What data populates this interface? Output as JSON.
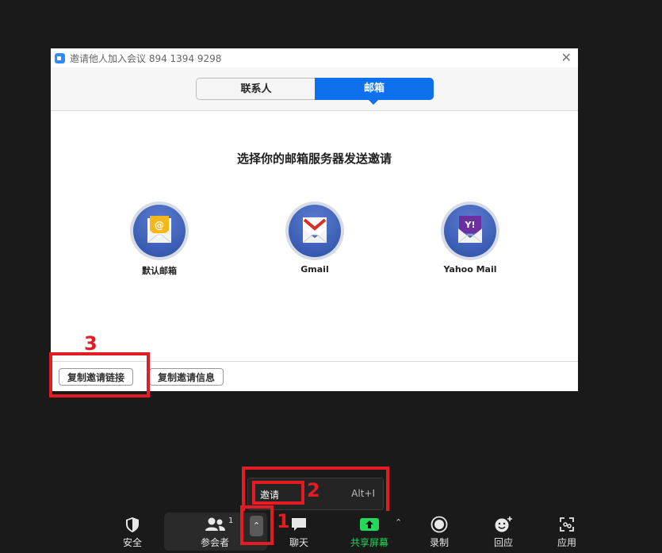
{
  "dialog": {
    "title": "邀请他人加入会议 894 1394 9298",
    "tabs": [
      "联系人",
      "邮箱"
    ],
    "active_tab": "邮箱",
    "prompt": "选择你的邮箱服务器发送邀请",
    "providers": [
      {
        "label": "默认邮箱",
        "icon": "default-mail-icon"
      },
      {
        "label": "Gmail",
        "icon": "gmail-icon"
      },
      {
        "label": "Yahoo Mail",
        "icon": "yahoo-mail-icon"
      }
    ],
    "buttons": {
      "copy_link": "复制邀请链接",
      "copy_info": "复制邀请信息"
    }
  },
  "menu": {
    "label": "邀请",
    "shortcut": "Alt+I"
  },
  "toolbar": {
    "security": "安全",
    "participants": "参会者",
    "participants_count": "1",
    "chat": "聊天",
    "share": "共享屏幕",
    "record": "录制",
    "reactions": "回应",
    "apps": "应用"
  },
  "annotations": [
    "1",
    "2",
    "3"
  ],
  "colors": {
    "accent": "#0e71eb",
    "annotation": "#e31b23",
    "share_green": "#23d959"
  }
}
